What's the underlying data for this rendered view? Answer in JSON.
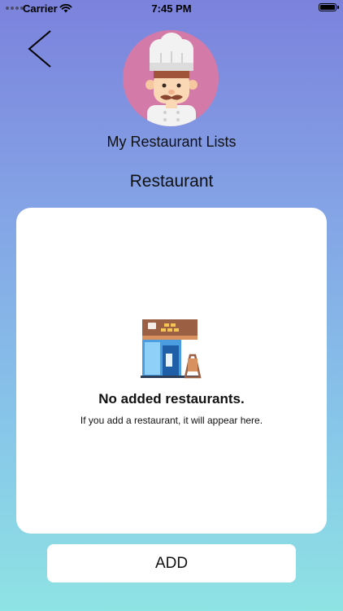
{
  "status_bar": {
    "carrier": "Carrier",
    "time": "7:45 PM"
  },
  "header": {
    "title": "My Restaurant Lists",
    "section_title": "Restaurant"
  },
  "empty_state": {
    "title": "No added restaurants.",
    "message": "If you add a restaurant, it will appear here."
  },
  "actions": {
    "add_label": "ADD"
  },
  "icons": {
    "back": "chevron-left-icon",
    "avatar": "chef-avatar-icon",
    "empty": "restaurant-storefront-icon",
    "wifi": "wifi-icon",
    "battery": "battery-icon"
  },
  "colors": {
    "gradient_top": "#7b82dc",
    "gradient_bottom": "#8ee3e3",
    "avatar_bg": "#d47aa8",
    "card_bg": "#ffffff"
  }
}
